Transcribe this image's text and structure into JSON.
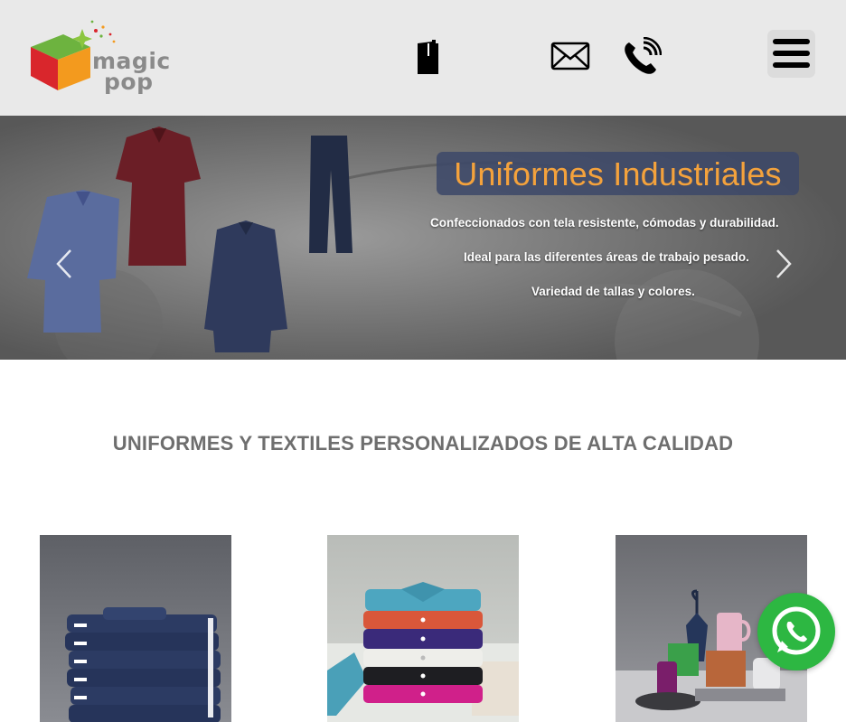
{
  "header": {
    "logo": {
      "line1": "magic",
      "line2": "pop"
    },
    "icons": [
      "catalog-icon",
      "mail-icon",
      "phone-icon",
      "hamburger-menu-icon"
    ]
  },
  "hero": {
    "title": "Uniformes Industriales",
    "lines": [
      "Confeccionados con tela resistente, cómodas y durabilidad.",
      "Ideal para las diferentes áreas de trabajo pesado.",
      "Variedad de tallas y colores."
    ],
    "colors": {
      "title": "#f4a23c",
      "title_box": "#3c4869"
    }
  },
  "section": {
    "title": "UNIFORMES Y TEXTILES PERSONALIZADOS DE ALTA CALIDAD"
  },
  "products": [
    {
      "image": "stacked-navy-uniforms"
    },
    {
      "image": "stacked-colored-polo-shirts"
    },
    {
      "image": "promotional-items-umbrella-mugs"
    }
  ],
  "whatsapp": {
    "icon": "whatsapp-icon",
    "color": "#2db742"
  }
}
